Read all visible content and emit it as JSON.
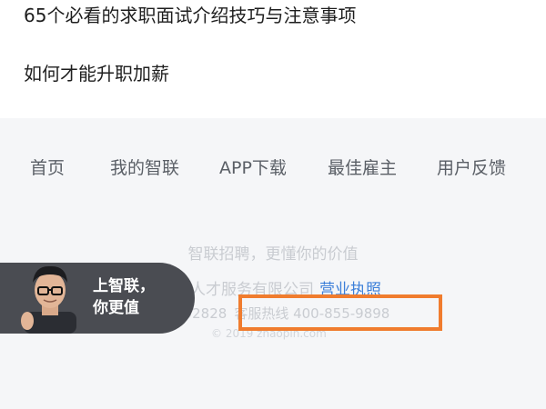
{
  "articles": [
    "65个必看的求职面试介绍技巧与注意事项",
    "如何才能升职加薪"
  ],
  "footer": {
    "nav": {
      "home": "首页",
      "my_zhilian": "我的智联",
      "app_download": "APP下载",
      "best_employer": "最佳雇主",
      "feedback": "用户反馈"
    },
    "slogan": "智联招聘，更懂你的价值",
    "company_name": "联三珂人才服务有限公司",
    "license_link": "营业执照",
    "phone_partial": "0-58692828",
    "hotline": "客服热线 400-855-9898",
    "copyright": "© 2019 zhaopin.com"
  },
  "promo": {
    "line1": "上智联，",
    "line2": "你更值"
  },
  "colors": {
    "highlight_box": "#f07c2e",
    "promo_background": "#4a4c52",
    "link": "#3c7fd9"
  }
}
